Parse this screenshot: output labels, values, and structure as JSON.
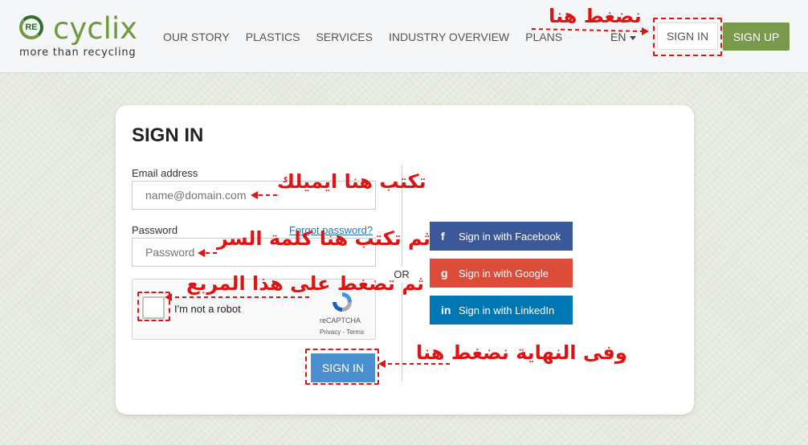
{
  "header": {
    "logo": {
      "badge": "RE",
      "word": "cyclix",
      "tagline": "more than recycling"
    },
    "nav": [
      "OUR STORY",
      "PLASTICS",
      "SERVICES",
      "INDUSTRY OVERVIEW",
      "PLANS"
    ],
    "language": "EN",
    "sign_in": "SIGN IN",
    "sign_up": "SIGN UP"
  },
  "form": {
    "title": "SIGN IN",
    "email_label": "Email address",
    "email_placeholder": "name@domain.com",
    "password_label": "Password",
    "password_placeholder": "Password",
    "forgot": "Forgot password?",
    "captcha": {
      "text": "I'm not a robot",
      "brand": "reCAPTCHA",
      "links": "Privacy - Terms"
    },
    "submit": "SIGN IN",
    "or": "OR"
  },
  "social": {
    "facebook": "Sign in with Facebook",
    "google": "Sign in with Google",
    "linkedin": "Sign in with LinkedIn"
  },
  "annotations": {
    "click_here": "نضغط هنا",
    "email_here": "تكتب هنا ايميلك",
    "password_here": "ثم تكتب هنا كلمة السر",
    "checkbox_here": "ثم تضغط على هذا المربع",
    "finally": "وفى النهاية نضغط هنا"
  },
  "colors": {
    "brand_green": "#6f9a3e",
    "signup_bg": "#7a9a4b",
    "annotation_red": "#e01212",
    "submit_blue": "#4a8fd0"
  }
}
